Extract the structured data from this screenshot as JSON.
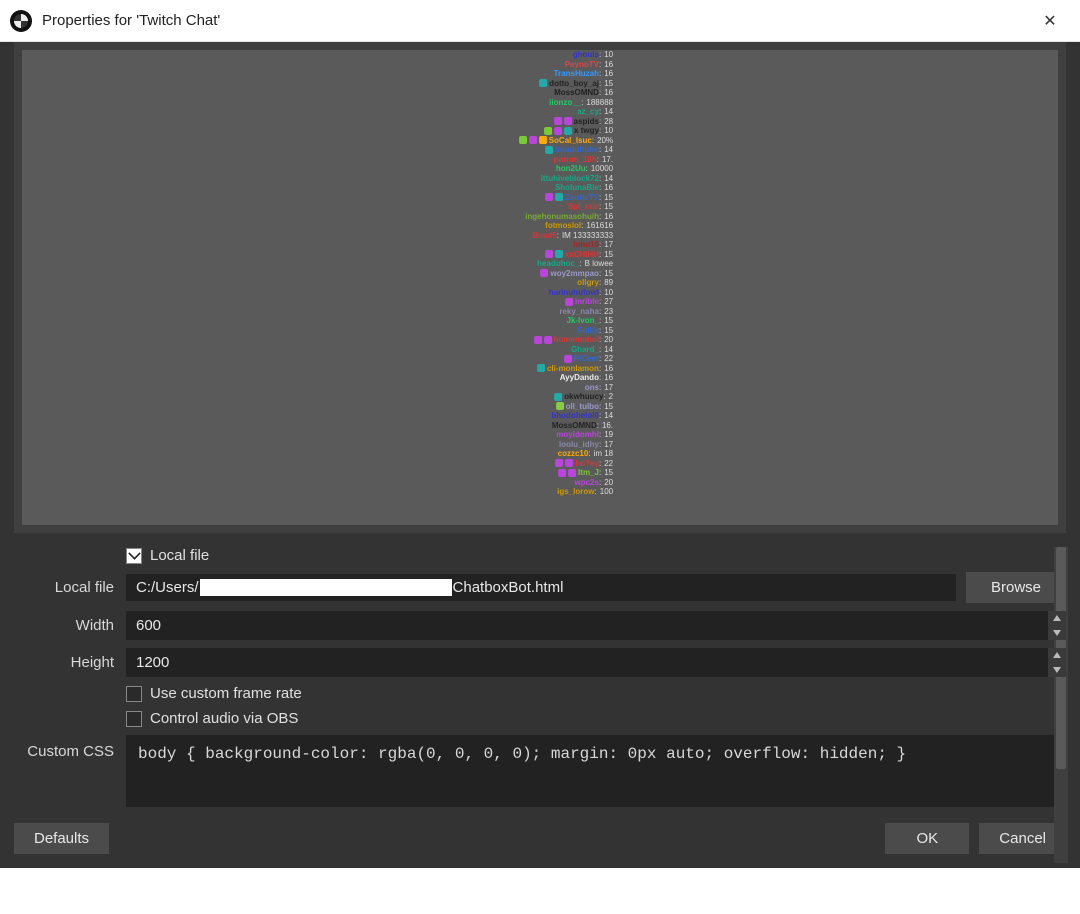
{
  "titlebar": {
    "title": "Properties for 'Twitch Chat'"
  },
  "form": {
    "local_file_cb_label": "Local file",
    "local_file_cb_checked": true,
    "local_file_label": "Local file",
    "local_file_prefix": "C:/Users/",
    "local_file_suffix": "ChatboxBot.html",
    "browse_label": "Browse",
    "width_label": "Width",
    "width_value": "600",
    "height_label": "Height",
    "height_value": "1200",
    "custom_fr_cb_label": "Use custom frame rate",
    "custom_fr_checked": false,
    "control_audio_cb_label": "Control audio via OBS",
    "control_audio_checked": false,
    "custom_css_label": "Custom CSS",
    "custom_css_value": "body { background-color: rgba(0, 0, 0, 0); margin: 0px auto; overflow: hidden; }"
  },
  "footer": {
    "defaults": "Defaults",
    "ok": "OK",
    "cancel": "Cancel"
  },
  "chat": [
    {
      "badges": [],
      "name": "ghouls",
      "color": "#33c",
      "msg": "10"
    },
    {
      "badges": [],
      "name": "PeynoTV",
      "color": "#d44",
      "msg": "16"
    },
    {
      "badges": [],
      "name": "TransHuzah",
      "color": "#39f",
      "msg": "16"
    },
    {
      "badges": [
        "#2aa"
      ],
      "name": "dotto_boy_aj",
      "color": "#222",
      "msg": "15"
    },
    {
      "badges": [],
      "name": "MossOMND",
      "color": "#222",
      "msg": "16"
    },
    {
      "badges": [],
      "name": "iionzo__",
      "color": "#2c6",
      "msg": "188888"
    },
    {
      "badges": [],
      "name": "az_cy",
      "color": "#1a8",
      "msg": "14"
    },
    {
      "badges": [
        "#b4d",
        "#b4d"
      ],
      "name": "aspids",
      "color": "#222",
      "msg": "28"
    },
    {
      "badges": [
        "#7c3",
        "#b4d",
        "#2aa"
      ],
      "name": "x twgy",
      "color": "#222",
      "msg": "10"
    },
    {
      "badges": [
        "#7c3",
        "#b4d",
        "#fa0"
      ],
      "name": "SoCal_lsuc",
      "color": "#fa0",
      "msg": "20%"
    },
    {
      "badges": [
        "#2aa"
      ],
      "name": "doudohuho",
      "color": "#36c",
      "msg": "14"
    },
    {
      "badges": [],
      "name": "pornm_18h",
      "color": "#d33",
      "msg": "17."
    },
    {
      "badges": [],
      "name": "hon2Uu",
      "color": "#2c6",
      "msg": "10000"
    },
    {
      "badges": [],
      "name": "ittuhiveblock72",
      "color": "#1a8",
      "msg": "14"
    },
    {
      "badges": [],
      "name": "SholunaBle",
      "color": "#1a8",
      "msg": "16"
    },
    {
      "badges": [
        "#b4d",
        "#2aa"
      ],
      "name": "ZxotlcTV",
      "color": "#36c",
      "msg": "15"
    },
    {
      "badges": [],
      "name": "Spl_rale",
      "color": "#d33",
      "msg": "15"
    },
    {
      "badges": [],
      "name": "ingehonumasohuih",
      "color": "#7a3",
      "msg": "16"
    },
    {
      "badges": [],
      "name": "fotmoslol",
      "color": "#c90",
      "msg": "161616"
    },
    {
      "badges": [],
      "name": "Busd5",
      "color": "#d33",
      "msg": "IM 133333333"
    },
    {
      "badges": [],
      "name": "hmu10",
      "color": "#a22",
      "msg": "17"
    },
    {
      "badges": [
        "#b4d",
        "#2aa"
      ],
      "name": "xxCHIHH",
      "color": "#d33",
      "msg": "15"
    },
    {
      "badges": [],
      "name": "headohoc_",
      "color": "#1a8",
      "msg": "B lowee"
    },
    {
      "badges": [
        "#b4d"
      ],
      "name": "woy2mmpao",
      "color": "#99c",
      "msg": "15"
    },
    {
      "badges": [],
      "name": "ollgry",
      "color": "#c90",
      "msg": "89"
    },
    {
      "badges": [],
      "name": "harinuhufowl",
      "color": "#33c",
      "msg": "10"
    },
    {
      "badges": [
        "#b4d"
      ],
      "name": "inrible",
      "color": "#b4d",
      "msg": "27"
    },
    {
      "badges": [],
      "name": "reky_naha",
      "color": "#88a",
      "msg": "23"
    },
    {
      "badges": [],
      "name": "Jk-lvon_",
      "color": "#2c6",
      "msg": "15"
    },
    {
      "badges": [],
      "name": "Folllp",
      "color": "#36c",
      "msg": "15"
    },
    {
      "badges": [
        "#b4d",
        "#b4d"
      ],
      "name": "homemohol",
      "color": "#d33",
      "msg": "20"
    },
    {
      "badges": [],
      "name": "Ghard_",
      "color": "#1a8",
      "msg": "14"
    },
    {
      "badges": [
        "#b4d"
      ],
      "name": "PiCeer",
      "color": "#36c",
      "msg": "22"
    },
    {
      "badges": [
        "#2aa"
      ],
      "name": "cli-monlamon",
      "color": "#c90",
      "msg": "16"
    },
    {
      "badges": [],
      "name": "AyyDando",
      "color": "#eee",
      "msg": "16"
    },
    {
      "badges": [],
      "name": "ons",
      "color": "#99c",
      "msg": "17"
    },
    {
      "badges": [
        "#2aa"
      ],
      "name": "okwhuucy",
      "color": "#222",
      "msg": "2"
    },
    {
      "badges": [
        "#8c4"
      ],
      "name": "oll_tulbo",
      "color": "#99c",
      "msg": "15"
    },
    {
      "badges": [],
      "name": "bhodohelol0",
      "color": "#33c",
      "msg": "14"
    },
    {
      "badges": [],
      "name": "MossOMND",
      "color": "#222",
      "msg": "16."
    },
    {
      "badges": [],
      "name": "moyidomhl",
      "color": "#b4d",
      "msg": "19"
    },
    {
      "badges": [],
      "name": "loolu_idhy",
      "color": "#88a",
      "msg": "17"
    },
    {
      "badges": [],
      "name": "cozzc10",
      "color": "#fa0",
      "msg": "im 18"
    },
    {
      "badges": [
        "#b4d",
        "#b4d"
      ],
      "name": "ho?ey",
      "color": "#d33",
      "msg": "22"
    },
    {
      "badges": [
        "#b4d",
        "#b4d"
      ],
      "name": "Itm_J",
      "color": "#7c3",
      "msg": "15"
    },
    {
      "badges": [],
      "name": "wpc2s",
      "color": "#b4d",
      "msg": "20"
    },
    {
      "badges": [],
      "name": "igs_lorow",
      "color": "#c90",
      "msg": "100"
    }
  ]
}
